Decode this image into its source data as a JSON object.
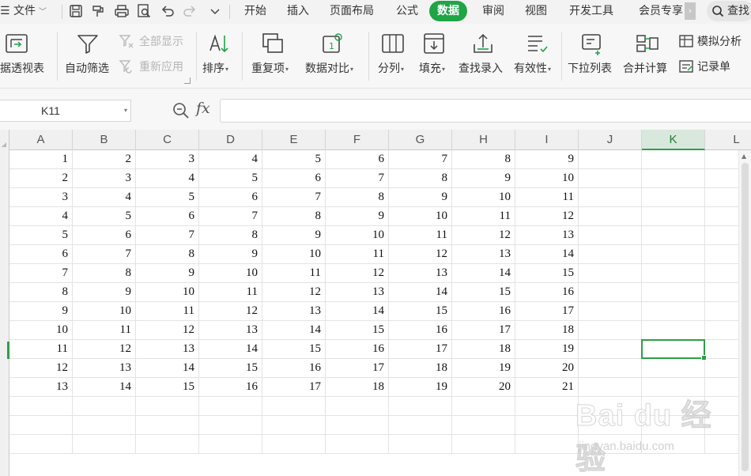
{
  "menu": {
    "file_label": "文件",
    "tabs": [
      "开始",
      "插入",
      "页面布局",
      "公式",
      "数据",
      "审阅",
      "视图",
      "开发工具",
      "会员专享"
    ],
    "active_tab": "数据",
    "search_label": "查找"
  },
  "ribbon": {
    "pivot": "据透视表",
    "autofilter": "自动筛选",
    "show_all": "全部显示",
    "reapply": "重新应用",
    "sort": "排序",
    "duplicates": "重复项",
    "compare": "数据对比",
    "split": "分列",
    "fill": "填充",
    "lookup_entry": "查找录入",
    "validity": "有效性",
    "dropdown_list": "下拉列表",
    "consolidate": "合并计算",
    "what_if": "模拟分析",
    "record_form": "记录单"
  },
  "formula_bar": {
    "cell_ref": "K11",
    "fx_label": "fx",
    "formula": ""
  },
  "sheet": {
    "columns": [
      "A",
      "B",
      "C",
      "D",
      "E",
      "F",
      "G",
      "H",
      "I",
      "J",
      "K",
      "L"
    ],
    "selected_column": "K",
    "selected_cell": "K11",
    "rows": [
      [
        1,
        2,
        3,
        4,
        5,
        6,
        7,
        8,
        9
      ],
      [
        2,
        3,
        4,
        5,
        6,
        7,
        8,
        9,
        10
      ],
      [
        3,
        4,
        5,
        6,
        7,
        8,
        9,
        10,
        11
      ],
      [
        4,
        5,
        6,
        7,
        8,
        9,
        10,
        11,
        12
      ],
      [
        5,
        6,
        7,
        8,
        9,
        10,
        11,
        12,
        13
      ],
      [
        6,
        7,
        8,
        9,
        10,
        11,
        12,
        13,
        14
      ],
      [
        7,
        8,
        9,
        10,
        11,
        12,
        13,
        14,
        15
      ],
      [
        8,
        9,
        10,
        11,
        12,
        13,
        14,
        15,
        16
      ],
      [
        9,
        10,
        11,
        12,
        13,
        14,
        15,
        16,
        17
      ],
      [
        10,
        11,
        12,
        13,
        14,
        15,
        16,
        17,
        18
      ],
      [
        11,
        12,
        13,
        14,
        15,
        16,
        17,
        18,
        19
      ],
      [
        12,
        13,
        14,
        15,
        16,
        17,
        18,
        19,
        20
      ],
      [
        13,
        14,
        15,
        16,
        17,
        18,
        19,
        20,
        21
      ]
    ]
  },
  "watermark": {
    "brand": "Bai du 经验",
    "url": "jingyan.baidu.com"
  },
  "colors": {
    "accent": "#1fa446",
    "selection": "#2e9e49",
    "grid_line": "#e3e3e3"
  }
}
